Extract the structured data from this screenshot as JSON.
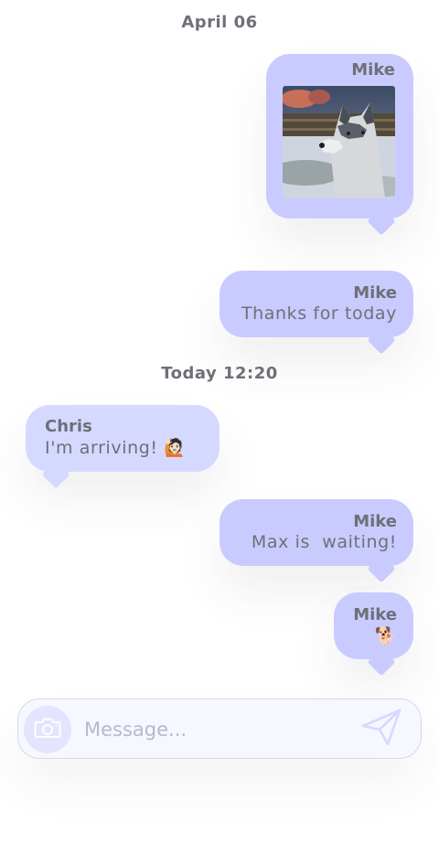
{
  "conversation": {
    "date_1": "April 06",
    "date_2": "Today 12:20",
    "messages": [
      {
        "sender": "Mike",
        "type": "image",
        "image_subject": "husky dog photo"
      },
      {
        "sender": "Mike",
        "text": "Thanks for today"
      },
      {
        "sender": "Chris",
        "text": "I'm arriving!",
        "emoji": "🙋🏻"
      },
      {
        "sender": "Mike",
        "text": "Max is  waiting!"
      },
      {
        "sender": "Mike",
        "emoji": "🐕"
      }
    ]
  },
  "composer": {
    "placeholder": "Message...",
    "camera_icon": "camera-icon",
    "send_icon": "send-icon"
  },
  "colors": {
    "outgoing_bubble": "#c9cbff",
    "incoming_bubble": "#d6d9ff",
    "text": "#6f6f78",
    "composer_bg": "#f6f7ff"
  }
}
